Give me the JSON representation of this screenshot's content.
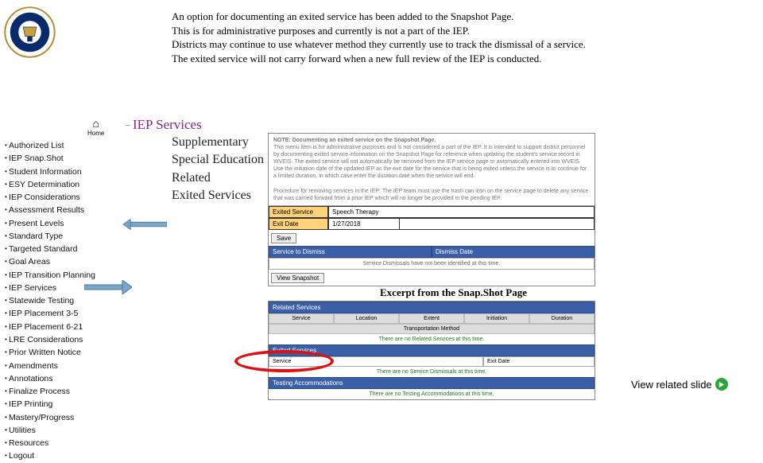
{
  "intro": {
    "l1": "An option for documenting an exited service has been added to the Snapshot Page.",
    "l2": "This is for administrative purposes and currently is not a part of the IEP.",
    "l3": "Districts may continue to use whatever method they currently use to track the dismissal of  a service.",
    "l4": "The exited service will not carry forward when a new full review of the IEP is conducted."
  },
  "home_label": "Home",
  "section_title": "IEP Services",
  "subitems": [
    "Supplementary",
    "Special Education",
    "Related",
    "Exited Services"
  ],
  "sidebar_items": [
    "Authorized List",
    "IEP Snap.Shot",
    "Student Information",
    "ESY Determination",
    "IEP Considerations",
    "Assessment Results",
    "Present Levels",
    "Standard Type",
    "Targeted Standard",
    "Goal Areas",
    "IEP Transition Planning",
    "IEP Services",
    "Statewide Testing",
    "IEP Placement 3-5",
    "IEP Placement 6-21",
    "LRE Considerations",
    "Prior Written Notice",
    "Amendments",
    "Annotations",
    "Finalize Process",
    "IEP Printing",
    "Mastery/Progress",
    "Utilities",
    "Resources",
    "Logout"
  ],
  "snapshot_top": {
    "note_title": "NOTE: Documenting an exited service on the Snapshot Page.",
    "note_body": "This menu item is for administrative purposes and is not considered a part of the IEP. It is intended to support district personnel by documenting exited service information on the Snapshot Page for reference when updating the student's service record in WVEIS. The exited service will not automatically be removed from the IEP service page or automatically entered into WVEIS. Use the initiation date of the updated IEP as the exit date for the service that is being exited unless the service is to continue for a limited duration, in which case enter the duration date when the service will end.",
    "note_proc": "Procedure for removing services in the IEP: The IEP team must use the trash can icon on the service page to delete any service that was carried forward from a prior IEP which will no longer be provided in the pending IEP.",
    "exited_label": "Exited Service",
    "exited_value": "Speech Therapy",
    "exitdate_label": "Exit Date",
    "exitdate_value": "1/27/2018",
    "save": "Save",
    "col1": "Service to Dismiss",
    "col2": "Dismiss Date",
    "empty": "Service Dismissals have not been identified at this time.",
    "view": "View Snapshot"
  },
  "excerpt_title": "Excerpt from the Snap.Shot Page",
  "snapshot_bot": {
    "related": "Related Services",
    "g1": "Service",
    "g2": "Location",
    "g3": "Extent",
    "g4": "Initiation",
    "g5": "Duration",
    "g_sub": "Transportation Method",
    "none_related": "There are no Related Services at this time.",
    "exited": "Exited Services",
    "ex_col1": "Service",
    "ex_col2": "Exit Date",
    "none_exited": "There are no Service Dismissals at this time.",
    "testing": "Testing Accommodations",
    "none_testing": "There are no Testing Accommodations at this time."
  },
  "view_related_label": "View related slide"
}
